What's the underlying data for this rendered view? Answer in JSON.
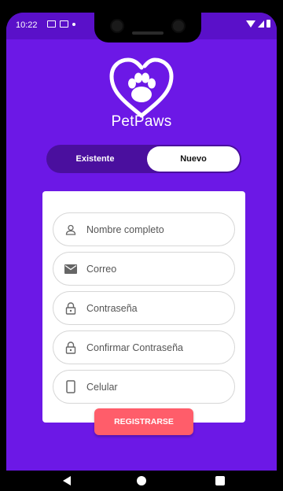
{
  "status_bar": {
    "time": "10:22",
    "icons": [
      "sim-icon",
      "calendar-icon",
      "dot-icon",
      "wifi-icon",
      "signal-icon",
      "battery-icon"
    ]
  },
  "brand": {
    "name": "PetPaws",
    "logo_icon": "heart-paw-icon"
  },
  "segment": {
    "left_label": "Existente",
    "right_label": "Nuevo",
    "selected": "Nuevo"
  },
  "form": {
    "fields": [
      {
        "icon": "person-icon",
        "placeholder": "Nombre completo",
        "value": ""
      },
      {
        "icon": "mail-icon",
        "placeholder": "Correo",
        "value": ""
      },
      {
        "icon": "lock-icon",
        "placeholder": "Contraseña",
        "value": ""
      },
      {
        "icon": "lock-icon",
        "placeholder": "Confirmar Contraseña",
        "value": ""
      },
      {
        "icon": "phone-icon",
        "placeholder": "Celular",
        "value": ""
      }
    ],
    "submit_label": "REGISTRARSE"
  },
  "colors": {
    "background": "#6c18e6",
    "segment_bg": "#4a0f9e",
    "button": "#ff5d6a"
  },
  "nav": {
    "icons": [
      "back-icon",
      "home-icon",
      "recents-icon"
    ]
  }
}
